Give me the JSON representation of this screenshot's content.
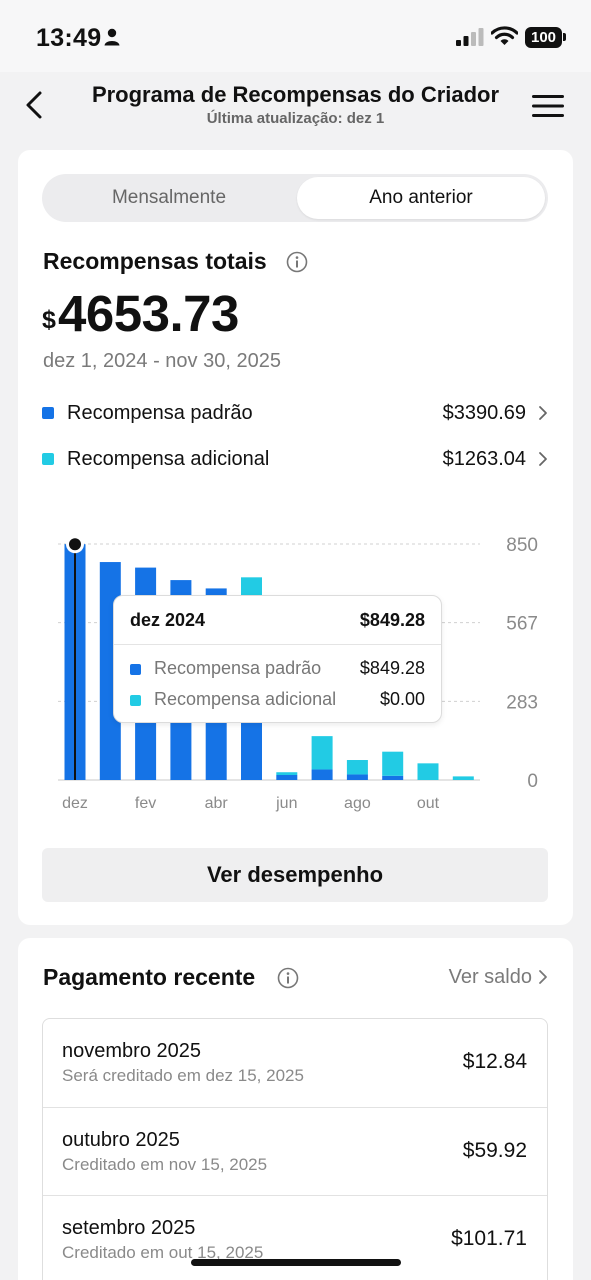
{
  "status_bar": {
    "time": "13:49",
    "battery": "100"
  },
  "header": {
    "title": "Programa de Recompensas do Criador",
    "subtitle": "Última atualização: dez 1"
  },
  "tabs": {
    "monthly": "Mensalmente",
    "previous_year": "Ano anterior",
    "selected": "Ano anterior"
  },
  "summary": {
    "label": "Recompensas totais",
    "currency": "$",
    "amount": "4653.73",
    "date_range": "dez 1, 2024 - nov 30, 2025"
  },
  "legend": [
    {
      "label": "Recompensa padrão",
      "value": "$3390.69",
      "color": "#1573e6"
    },
    {
      "label": "Recompensa adicional",
      "value": "$1263.04",
      "color": "#22cbe4"
    }
  ],
  "chart_data": {
    "type": "bar",
    "stacked": true,
    "categories": [
      "dez",
      "jan",
      "fev",
      "mar",
      "abr",
      "mai",
      "jun",
      "jul",
      "ago",
      "set",
      "out",
      "nov"
    ],
    "x_tick_labels": [
      "dez",
      "fev",
      "abr",
      "jun",
      "ago",
      "out"
    ],
    "series": [
      {
        "name": "Recompensa padrão",
        "color": "#1573e6",
        "values": [
          849.28,
          785,
          765,
          720,
          690,
          470,
          18,
          38,
          20,
          15,
          0,
          0
        ]
      },
      {
        "name": "Recompensa adicional",
        "color": "#22cbe4",
        "values": [
          0,
          0,
          0,
          0,
          0,
          260,
          10,
          120,
          52,
          87,
          60,
          13
        ]
      }
    ],
    "y_ticks": [
      0,
      283,
      567,
      850
    ],
    "ylim": [
      0,
      850
    ],
    "grid": true,
    "selected_index": 0
  },
  "tooltip": {
    "month": "dez 2024",
    "total": "$849.28",
    "rows": [
      {
        "label": "Recompensa padrão",
        "value": "$849.28"
      },
      {
        "label": "Recompensa adicional",
        "value": "$0.00"
      }
    ]
  },
  "actions": {
    "performance_button": "Ver desempenho"
  },
  "payments": {
    "title": "Pagamento recente",
    "link": "Ver saldo",
    "items": [
      {
        "month": "novembro 2025",
        "note": "Será creditado em dez 15, 2025",
        "amount": "$12.84"
      },
      {
        "month": "outubro 2025",
        "note": "Creditado em nov 15, 2025",
        "amount": "$59.92"
      },
      {
        "month": "setembro 2025",
        "note": "Creditado em out 15, 2025",
        "amount": "$101.71"
      }
    ]
  }
}
